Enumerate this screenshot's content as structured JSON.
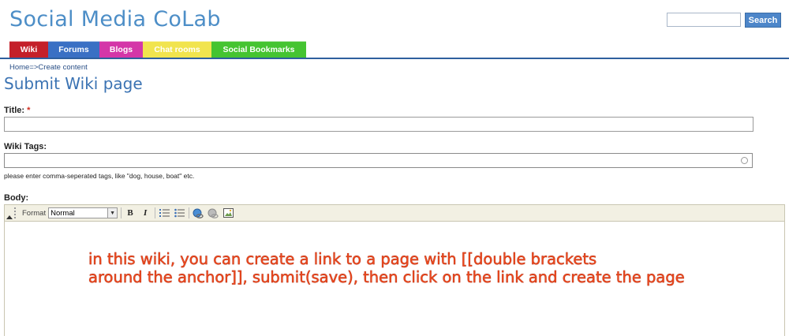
{
  "site": {
    "title": "Social Media CoLab"
  },
  "search": {
    "placeholder": "",
    "button_label": "Search"
  },
  "nav": {
    "tabs": [
      {
        "label": "Wiki",
        "color": "#c4202a"
      },
      {
        "label": "Forums",
        "color": "#3a70c4"
      },
      {
        "label": "Blogs",
        "color": "#d436a8"
      },
      {
        "label": "Chat rooms",
        "color": "#f1e44e"
      },
      {
        "label": "Social Bookmarks",
        "color": "#45c431"
      }
    ]
  },
  "breadcrumb": "Home=>Create content",
  "page": {
    "title": "Submit Wiki page"
  },
  "form": {
    "title_label": "Title:",
    "required_mark": "*",
    "title_value": "",
    "tags_label": "Wiki Tags:",
    "tags_value": "",
    "tags_help": "please enter comma-seperated tags, like \"dog, house, boat\" etc.",
    "body_label": "Body:"
  },
  "editor": {
    "format_label": "Format",
    "format_value": "Normal",
    "buttons": {
      "bold": "B",
      "italic": "I"
    },
    "icons": [
      "ordered-list-icon",
      "unordered-list-icon",
      "link-icon",
      "unlink-icon",
      "image-icon"
    ]
  },
  "annotation": {
    "line1": "in this wiki, you can create a link to a page with [[double brackets",
    "line2": "around the anchor]], submit(save), then click on the link and create the page"
  }
}
